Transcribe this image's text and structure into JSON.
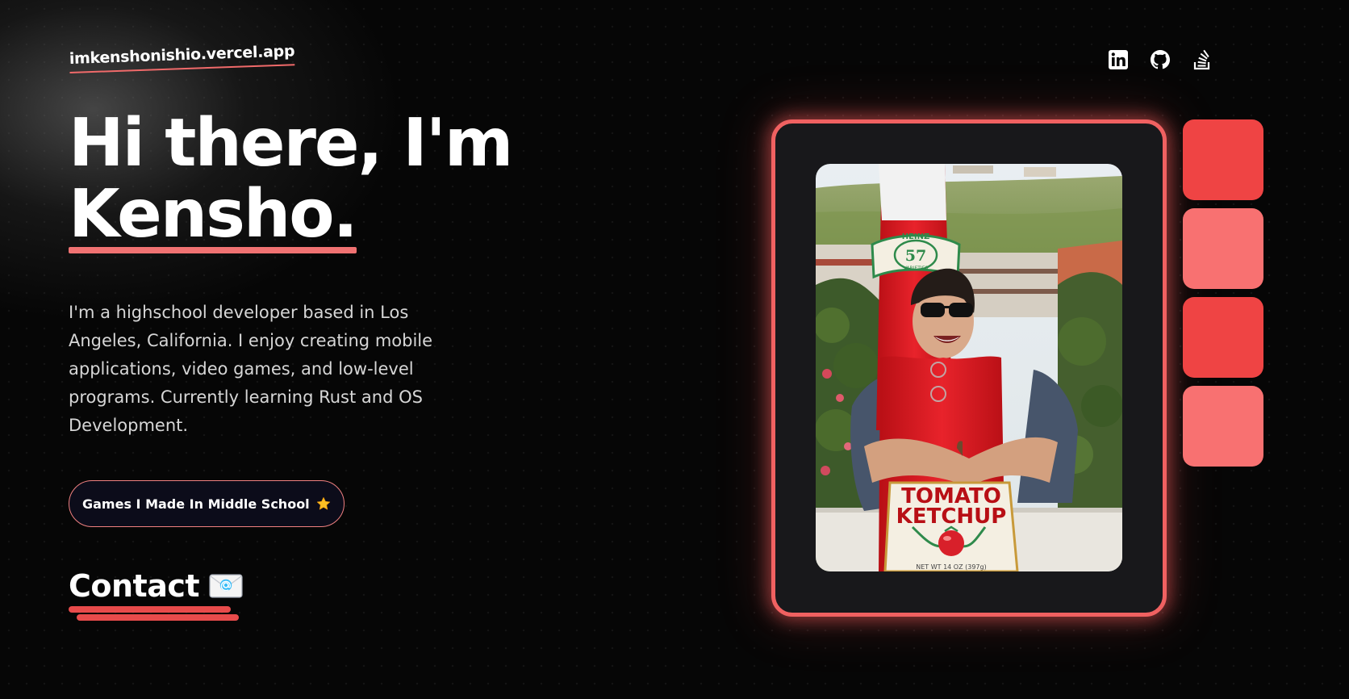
{
  "site": {
    "url_label": "imkenshonishio.vercel.app"
  },
  "social": [
    {
      "name": "LinkedIn",
      "icon": "linkedin-icon"
    },
    {
      "name": "GitHub",
      "icon": "github-icon"
    },
    {
      "name": "Stack Overflow",
      "icon": "stack-overflow-icon"
    }
  ],
  "hero": {
    "greeting": "Hi there, I'm",
    "name": "Kensho."
  },
  "bio": "I'm a highschool developer based in Los Angeles, California. I enjoy creating mobile applications, video games, and low-level programs. Currently learning Rust and OS Development.",
  "games_button": {
    "label": "Games I Made In Middle School",
    "icon": "star-icon"
  },
  "contact": {
    "title": "Contact",
    "icon": "envelope-icon"
  },
  "photo": {
    "costume_brand": "HEINZ",
    "costume_number": "57",
    "costume_sub": "VARIETIES",
    "costume_label_line1": "TOMATO",
    "costume_label_line2": "KETCHUP",
    "costume_net_wt": "NET WT 14 OZ (397g)"
  },
  "tiles": [
    {
      "color": "#ef4444"
    },
    {
      "color": "#f87171"
    },
    {
      "color": "#ef4444"
    },
    {
      "color": "#f87171"
    }
  ],
  "colors": {
    "accent": "#f06161",
    "accent_light": "#f87171",
    "accent_dark": "#ef4444",
    "background": "#060606",
    "frame_bg": "#18181b",
    "button_bg": "#0c0c1a"
  }
}
